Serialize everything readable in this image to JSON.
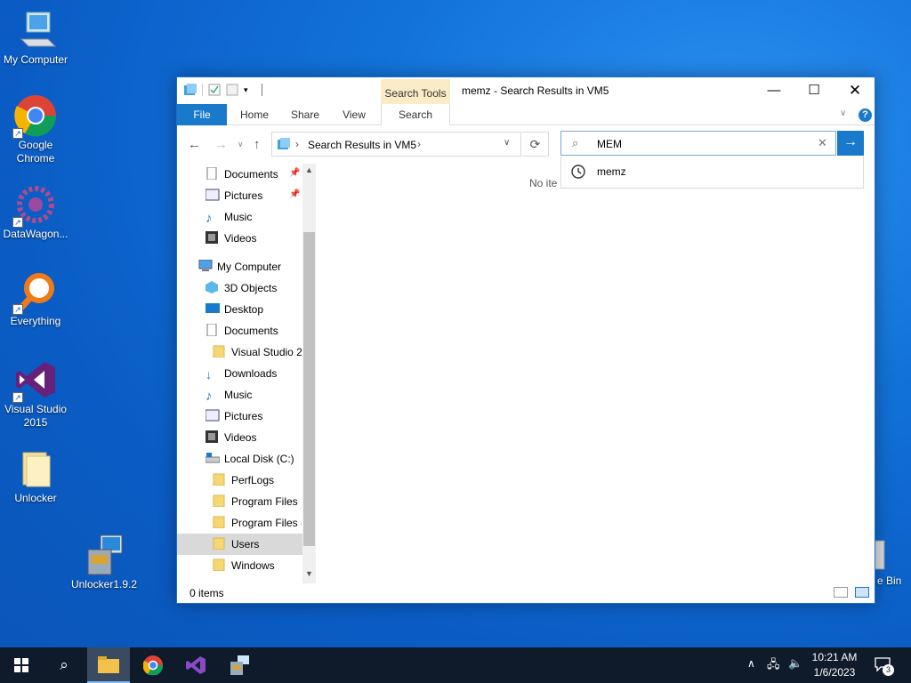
{
  "desktop": {
    "icons": [
      {
        "label": "My Computer"
      },
      {
        "label": "Google\nChrome"
      },
      {
        "label": "DataWagon..."
      },
      {
        "label": "Everything"
      },
      {
        "label": "Visual Studio\n2015"
      },
      {
        "label": "Unlocker"
      },
      {
        "label": "Unlocker1.9.2"
      },
      {
        "label": "e Bin"
      }
    ]
  },
  "window": {
    "title": "memz - Search Results in VM5",
    "context_tab": "Search Tools",
    "ribbon_tabs": [
      "File",
      "Home",
      "Share",
      "View",
      "Search"
    ],
    "address": "Search Results in VM5",
    "search": {
      "value": "MEM",
      "suggestion": "memz"
    },
    "content_text": "No ite",
    "status": "0 items",
    "nav": [
      {
        "label": "Documents",
        "pinned": true
      },
      {
        "label": "Pictures",
        "pinned": true
      },
      {
        "label": "Music"
      },
      {
        "label": "Videos"
      },
      {
        "label": "My Computer"
      },
      {
        "label": "3D Objects"
      },
      {
        "label": "Desktop"
      },
      {
        "label": "Documents"
      },
      {
        "label": "Visual Studio 2("
      },
      {
        "label": "Downloads"
      },
      {
        "label": "Music"
      },
      {
        "label": "Pictures"
      },
      {
        "label": "Videos"
      },
      {
        "label": "Local Disk (C:)"
      },
      {
        "label": "PerfLogs"
      },
      {
        "label": "Program Files"
      },
      {
        "label": "Program Files ("
      },
      {
        "label": "Users"
      },
      {
        "label": "Windows"
      }
    ]
  },
  "taskbar": {
    "time": "10:21 AM",
    "date": "1/6/2023",
    "notifications": "3"
  }
}
